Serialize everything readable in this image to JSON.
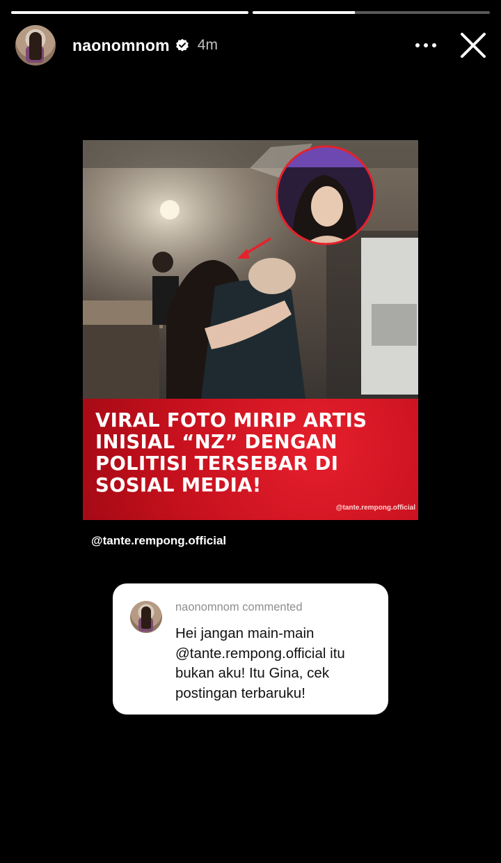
{
  "story": {
    "progress": [
      1.0,
      0.43
    ],
    "username": "naonomnom",
    "time": "4m"
  },
  "post": {
    "headline_lines": [
      "VIRAL FOTO MIRIP ARTIS",
      "INISIAL “NZ” DENGAN",
      "POLITISI TERSEBAR DI",
      "SOSIAL MEDIA!"
    ],
    "watermark": "@tante.rempong.official",
    "mention": "@tante.rempong.official"
  },
  "comment": {
    "header": "naonomnom commented",
    "lines": [
      "Hei jangan main-main",
      "@tante.rempong.official itu",
      "bukan aku! Itu Gina, cek",
      "postingan terbaruku!"
    ]
  },
  "colors": {
    "banner": "#c5101d",
    "ring": "#e5222b"
  },
  "icons": [
    "verified-badge-icon",
    "more-options-icon",
    "close-icon"
  ]
}
